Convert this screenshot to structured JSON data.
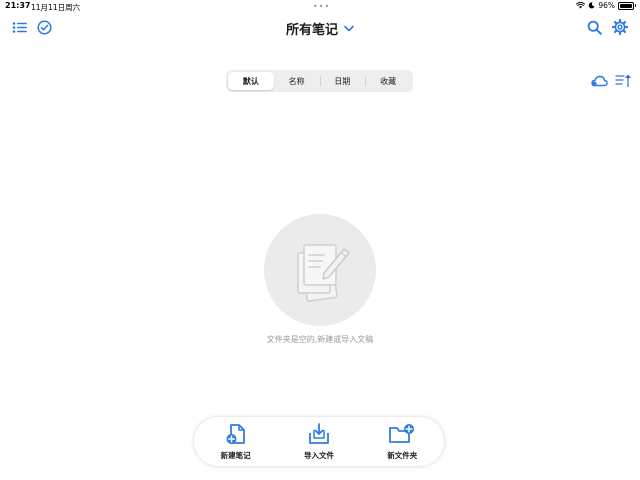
{
  "status": {
    "time": "21:37",
    "date": "11月11日周六",
    "battery_percent": "96%",
    "battery_level": 0.96,
    "dots": "•••"
  },
  "header": {
    "title": "所有笔记"
  },
  "sort_tabs": [
    {
      "label": "默认",
      "active": true
    },
    {
      "label": "名称",
      "active": false
    },
    {
      "label": "日期",
      "active": false
    },
    {
      "label": "收藏",
      "active": false
    }
  ],
  "empty_state": {
    "message": "文件夹是空的,新建或导入文稿"
  },
  "actions": {
    "new_note": "新建笔记",
    "import_file": "导入文件",
    "new_folder": "新文件夹"
  },
  "colors": {
    "accent": "#2f7be5",
    "background": "#ffffff",
    "segment_bg": "#eeeeef",
    "placeholder_circle": "#ebebeb"
  },
  "icons": {
    "list": "list-icon",
    "select": "checkmark-circle-icon",
    "search": "search-icon",
    "settings": "gear-icon",
    "cloud": "cloud-icon",
    "sort": "sort-icon",
    "empty": "notes-placeholder-icon"
  }
}
